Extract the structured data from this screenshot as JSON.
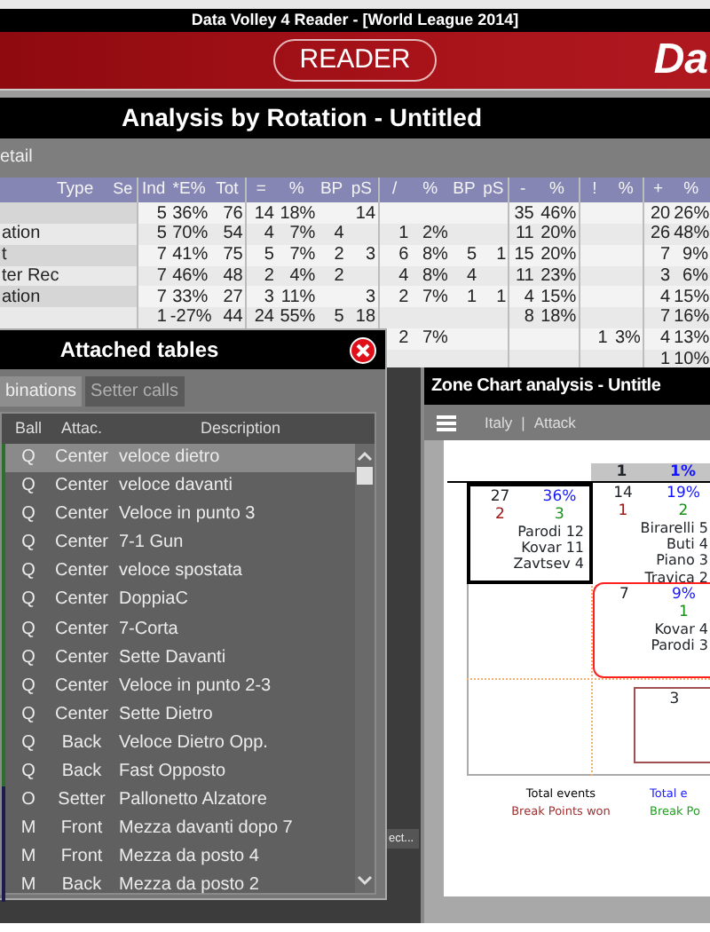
{
  "window": {
    "title": "Data Volley 4 Reader - [World League 2014]"
  },
  "banner": {
    "label": "READER",
    "logo": "Da"
  },
  "analysis": {
    "title": "Analysis by Rotation - Untitled",
    "tab": "etail",
    "columns": [
      "Type",
      "Se",
      "Ind",
      "*E%",
      "Tot",
      "=",
      "%",
      "BP",
      "pS",
      "/",
      "%",
      "BP",
      "pS",
      "-",
      "%",
      "!",
      "%",
      "+",
      "%"
    ],
    "rows": [
      {
        "cells": [
          null,
          null,
          "5",
          "36%",
          "76",
          "14",
          "18%",
          null,
          "14",
          null,
          null,
          null,
          null,
          "35",
          "46%",
          null,
          null,
          "20",
          "26%"
        ]
      },
      {
        "cells": [
          "ation",
          null,
          "5",
          "70%",
          "54",
          "4",
          "7%",
          "4",
          null,
          "1",
          "2%",
          null,
          null,
          "11",
          "20%",
          null,
          null,
          "26",
          "48%"
        ]
      },
      {
        "cells": [
          "t",
          null,
          "7",
          "41%",
          "75",
          "5",
          "7%",
          "2",
          "3",
          "6",
          "8%",
          "5",
          "1",
          "15",
          "20%",
          null,
          null,
          "7",
          "9%"
        ]
      },
      {
        "cells": [
          "ter Rec",
          null,
          "7",
          "46%",
          "48",
          "2",
          "4%",
          "2",
          null,
          "4",
          "8%",
          "4",
          null,
          "11",
          "23%",
          null,
          null,
          "3",
          "6%"
        ]
      },
      {
        "cells": [
          "ation",
          null,
          "7",
          "33%",
          "27",
          "3",
          "11%",
          null,
          "3",
          "2",
          "7%",
          "1",
          "1",
          "4",
          "15%",
          null,
          null,
          "4",
          "15%"
        ]
      },
      {
        "cells": [
          null,
          null,
          "1",
          "-27%",
          "44",
          "24",
          "55%",
          "5",
          "18",
          null,
          null,
          null,
          null,
          "8",
          "18%",
          null,
          null,
          "7",
          "16%"
        ]
      },
      {
        "cells": [
          null,
          null,
          null,
          null,
          null,
          null,
          null,
          null,
          null,
          "2",
          "7%",
          null,
          null,
          null,
          null,
          "1",
          "3%",
          "4",
          "13%"
        ]
      },
      {
        "cells": [
          null,
          null,
          null,
          null,
          null,
          null,
          null,
          null,
          null,
          null,
          null,
          null,
          null,
          null,
          null,
          null,
          null,
          "1",
          "10%"
        ]
      }
    ]
  },
  "side_button": {
    "label": "ect..."
  },
  "attached_tables": {
    "title": "Attached tables",
    "tabs": [
      {
        "label": "binations",
        "selected": true
      },
      {
        "label": "Setter calls",
        "selected": false
      }
    ],
    "columns": [
      "Ball",
      "Attac.",
      "Description"
    ],
    "rows": [
      {
        "ball": "Q",
        "attack": "Center",
        "description": "veloce dietro",
        "color": "#2e6e2e",
        "selected": true
      },
      {
        "ball": "Q",
        "attack": "Center",
        "description": "veloce davanti",
        "color": "#2e6e2e",
        "selected": false
      },
      {
        "ball": "Q",
        "attack": "Center",
        "description": "Veloce in punto 3",
        "color": "#2e6e2e",
        "selected": false
      },
      {
        "ball": "Q",
        "attack": "Center",
        "description": "7-1 Gun",
        "color": "#2e6e2e",
        "selected": false
      },
      {
        "ball": "Q",
        "attack": "Center",
        "description": "veloce spostata",
        "color": "#2e6e2e",
        "selected": false
      },
      {
        "ball": "Q",
        "attack": "Center",
        "description": "DoppiaC",
        "color": "#2e6e2e",
        "selected": false
      },
      {
        "ball": "Q",
        "attack": "Center",
        "description": "7-Corta",
        "color": "#2e6e2e",
        "selected": false
      },
      {
        "ball": "Q",
        "attack": "Center",
        "description": "Sette Davanti",
        "color": "#2e6e2e",
        "selected": false
      },
      {
        "ball": "Q",
        "attack": "Center",
        "description": "Veloce in punto 2-3",
        "color": "#2e6e2e",
        "selected": false
      },
      {
        "ball": "Q",
        "attack": "Center",
        "description": "Sette Dietro",
        "color": "#2e6e2e",
        "selected": false
      },
      {
        "ball": "Q",
        "attack": "Back",
        "description": "Veloce Dietro Opp.",
        "color": "#2e6e2e",
        "selected": false
      },
      {
        "ball": "Q",
        "attack": "Back",
        "description": "Fast  Opposto",
        "color": "#2e6e2e",
        "selected": false
      },
      {
        "ball": "O",
        "attack": "Setter",
        "description": "Pallonetto Alzatore",
        "color": "#1c1c50",
        "selected": false
      },
      {
        "ball": "M",
        "attack": "Front",
        "description": "Mezza davanti dopo 7",
        "color": "#1c1c50",
        "selected": false
      },
      {
        "ball": "M",
        "attack": "Front",
        "description": "Mezza da posto 4",
        "color": "#1c1c50",
        "selected": false
      },
      {
        "ball": "M",
        "attack": "Back",
        "description": "Mezza da posto 2",
        "color": "#1c1c50",
        "selected": false
      }
    ]
  },
  "zone_chart": {
    "title": "Zone Chart analysis - Untitle",
    "team": "Italy",
    "separator": "|",
    "skill": "Attack",
    "column_header": {
      "total": "1",
      "pct": "1%"
    },
    "zones": [
      {
        "total": "27",
        "pct": "36%",
        "bp": "2",
        "bp_share": "3",
        "players": [
          "Parodi 12",
          "Kovar 11",
          "Zavtsev 4"
        ],
        "color": "#000000"
      },
      {
        "total": "14",
        "pct": "19%",
        "bp": "1",
        "bp_share": "2",
        "players": [
          "Birarelli 5",
          "Buti 4",
          "Piano 3",
          "Travica 2"
        ]
      },
      {
        "total": "7",
        "pct": "9%",
        "bp_share": "1",
        "players": [
          "Kovar 4",
          "Parodi 3"
        ],
        "color": "#ff2020"
      },
      {
        "total": "3",
        "color": "#a05050"
      }
    ],
    "legend": [
      {
        "label": "Total events",
        "color": "#000000"
      },
      {
        "label": "Total e",
        "color": "#2020ff"
      },
      {
        "label": "Break Points won",
        "color": "#a03030"
      },
      {
        "label": "Break Po",
        "color": "#20a020"
      }
    ]
  }
}
